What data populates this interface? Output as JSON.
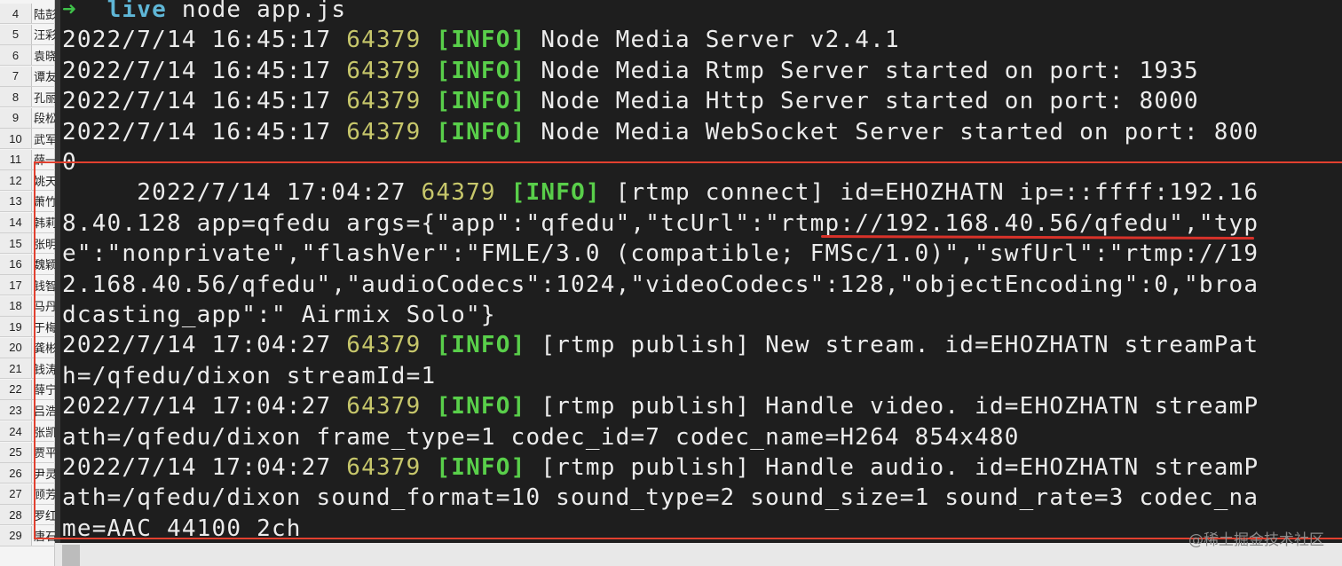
{
  "sheet": {
    "rows": [
      {
        "num": "4",
        "cell": "陆彭"
      },
      {
        "num": "5",
        "cell": "汪彩"
      },
      {
        "num": "6",
        "cell": "袁晓"
      },
      {
        "num": "7",
        "cell": "谭友"
      },
      {
        "num": "8",
        "cell": "孔丽"
      },
      {
        "num": "9",
        "cell": "段松"
      },
      {
        "num": "10",
        "cell": "武军"
      },
      {
        "num": "11",
        "cell": "薛一"
      },
      {
        "num": "12",
        "cell": "姚天"
      },
      {
        "num": "13",
        "cell": "萧竹"
      },
      {
        "num": "14",
        "cell": "韩莉"
      },
      {
        "num": "15",
        "cell": "张明"
      },
      {
        "num": "16",
        "cell": "魏颖"
      },
      {
        "num": "17",
        "cell": "钱智"
      },
      {
        "num": "18",
        "cell": "马丹"
      },
      {
        "num": "19",
        "cell": "于梅"
      },
      {
        "num": "20",
        "cell": "龚彬"
      },
      {
        "num": "21",
        "cell": "钱涛"
      },
      {
        "num": "22",
        "cell": "薛宁"
      },
      {
        "num": "23",
        "cell": "吕浩"
      },
      {
        "num": "24",
        "cell": "张凯"
      },
      {
        "num": "25",
        "cell": "贾平"
      },
      {
        "num": "26",
        "cell": "尹灵"
      },
      {
        "num": "27",
        "cell": "顾芳"
      },
      {
        "num": "28",
        "cell": "罗红"
      },
      {
        "num": "29",
        "cell": "唐石"
      }
    ]
  },
  "terminal": {
    "prompt": {
      "arrow": "➜",
      "dir": "live",
      "command": "node app.js"
    },
    "logs": [
      {
        "date": "2022/7/14 16:45:17",
        "pid": "64379",
        "level": "[INFO]",
        "msg": "Node Media Server v2.4.1"
      },
      {
        "date": "2022/7/14 16:45:17",
        "pid": "64379",
        "level": "[INFO]",
        "msg": "Node Media Rtmp Server started on port: 1935"
      },
      {
        "date": "2022/7/14 16:45:17",
        "pid": "64379",
        "level": "[INFO]",
        "msg": "Node Media Http Server started on port: 8000"
      },
      {
        "date": "2022/7/14 16:45:17",
        "pid": "64379",
        "level": "[INFO]",
        "msg": "Node Media WebSocket Server started on port: 800"
      }
    ],
    "wrap_after_ws": "0",
    "connect": {
      "indent": "     ",
      "date": "2022/7/14 17:04:27",
      "pid": "64379",
      "level": "[INFO]",
      "msg": "[rtmp connect] id=EHOZHATN ip=::ffff:192.16",
      "cont1": "8.40.128 app=qfedu args={\"app\":\"qfedu\",\"tcUrl\":\"rtmp://192.168.40.56/qfedu\",\"typ",
      "cont2": "e\":\"nonprivate\",\"flashVer\":\"FMLE/3.0 (compatible; FMSc/1.0)\",\"swfUrl\":\"rtmp://19",
      "cont3": "2.168.40.56/qfedu\",\"audioCodecs\":1024,\"videoCodecs\":128,\"objectEncoding\":0,\"broa",
      "cont4": "dcasting_app\":\" Airmix Solo\"}"
    },
    "publish": [
      {
        "date": "2022/7/14 17:04:27",
        "pid": "64379",
        "level": "[INFO]",
        "msg": "[rtmp publish] New stream. id=EHOZHATN streamPat",
        "cont": "h=/qfedu/dixon streamId=1"
      },
      {
        "date": "2022/7/14 17:04:27",
        "pid": "64379",
        "level": "[INFO]",
        "msg": "[rtmp publish] Handle video. id=EHOZHATN streamP",
        "cont": "ath=/qfedu/dixon frame_type=1 codec_id=7 codec_name=H264 854x480"
      },
      {
        "date": "2022/7/14 17:04:27",
        "pid": "64379",
        "level": "[INFO]",
        "msg": "[rtmp publish] Handle audio. id=EHOZHATN streamP",
        "cont": "ath=/qfedu/dixon sound_format=10 sound_type=2 sound_size=1 sound_rate=3 codec_na",
        "cont2": "me=AAC 44100 2ch"
      }
    ]
  },
  "watermark": "@稀土掘金技术社区",
  "colors": {
    "background": "#1e1e1e",
    "text": "#ececec",
    "pid": "#c7c76b",
    "info": "#59cf4a",
    "prompt_arrow": "#3fc24a",
    "prompt_dir": "#5fb6d6",
    "annotation": "#e2402f"
  }
}
